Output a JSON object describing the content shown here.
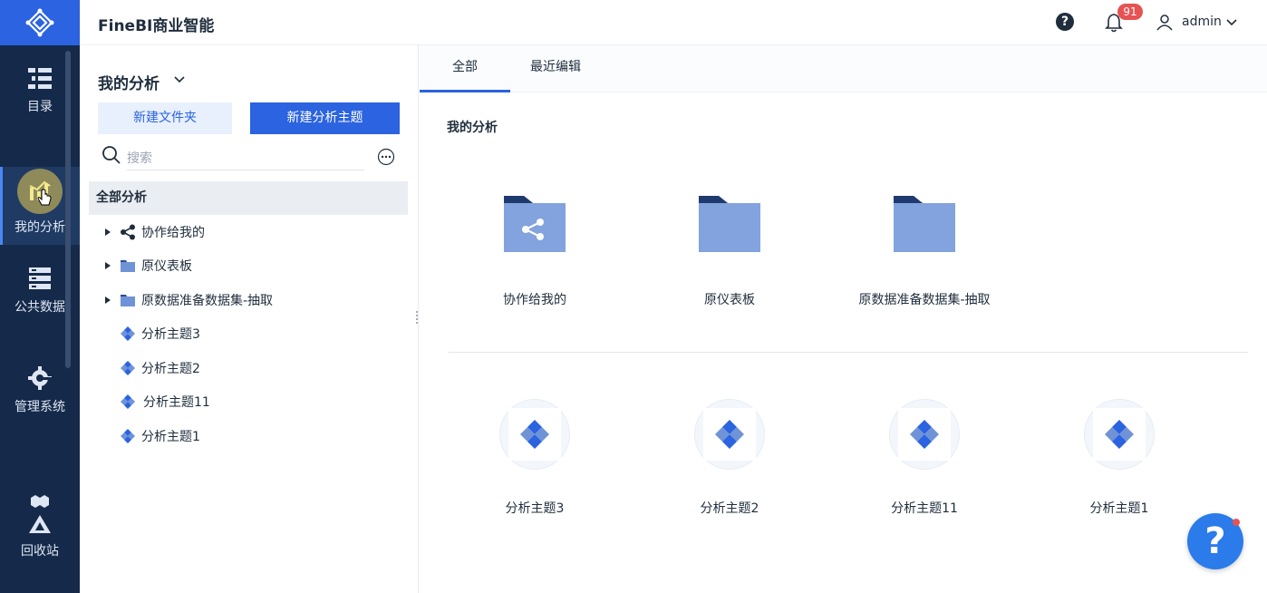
{
  "app": {
    "brand": "FineBI商业智能"
  },
  "rail": {
    "items": [
      {
        "label": "目录",
        "icon": "catalog-icon"
      },
      {
        "label": "我的分析",
        "icon": "analysis-icon",
        "active": true
      },
      {
        "label": "公共数据",
        "icon": "database-icon"
      },
      {
        "label": "管理系统",
        "icon": "gear-icon"
      },
      {
        "label": "回收站",
        "icon": "recycle-icon"
      }
    ]
  },
  "header": {
    "notification_count": "91",
    "user_name": "admin"
  },
  "panel": {
    "title": "我的分析",
    "new_folder_label": "新建文件夹",
    "new_theme_label": "新建分析主题",
    "search_placeholder": "搜索",
    "tree_root": "全部分析",
    "tree": [
      {
        "label": "协作给我的",
        "type": "shared-folder",
        "expandable": true
      },
      {
        "label": "原仪表板",
        "type": "folder",
        "expandable": true
      },
      {
        "label": "原数据准备数据集-抽取",
        "type": "folder",
        "expandable": true
      },
      {
        "label": "分析主题3",
        "type": "theme",
        "expandable": false
      },
      {
        "label": "分析主题2",
        "type": "theme",
        "expandable": false
      },
      {
        "label": "分析主题11",
        "type": "theme",
        "expandable": false
      },
      {
        "label": "分析主题1",
        "type": "theme",
        "expandable": false
      }
    ]
  },
  "main": {
    "tabs": [
      {
        "label": "全部",
        "active": true
      },
      {
        "label": "最近编辑",
        "active": false
      }
    ],
    "section_title": "我的分析",
    "folders": [
      {
        "name": "协作给我的",
        "shared": true
      },
      {
        "name": "原仪表板",
        "shared": false
      },
      {
        "name": "原数据准备数据集-抽取",
        "shared": false
      }
    ],
    "themes": [
      {
        "name": "分析主题3"
      },
      {
        "name": "分析主题2"
      },
      {
        "name": "分析主题11"
      },
      {
        "name": "分析主题1"
      }
    ]
  },
  "colors": {
    "accent": "#2b63e0",
    "rail_bg": "#152a4a",
    "folder": "#82a3dd",
    "folder_tab": "#1f3a6e",
    "badge": "#e65353"
  }
}
